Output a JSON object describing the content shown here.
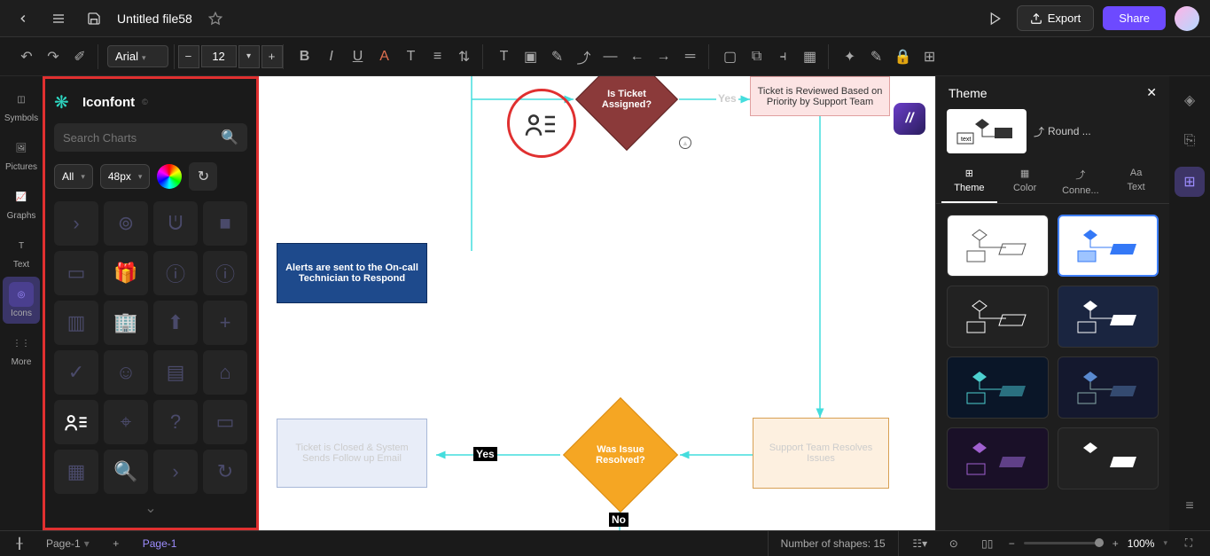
{
  "topbar": {
    "filename": "Untitled file58",
    "export_label": "Export",
    "share_label": "Share"
  },
  "toolbar": {
    "font": "Arial",
    "size": "12"
  },
  "left_nav": {
    "items": [
      "Symbols",
      "Pictures",
      "Graphs",
      "Text",
      "Icons",
      "More"
    ]
  },
  "icon_panel": {
    "title": "Iconfont",
    "search_placeholder": "Search Charts",
    "filter_all": "All",
    "size_label": "48px"
  },
  "flow": {
    "assigned": "Is Ticket Assigned?",
    "yes1": "Yes",
    "reviewed": "Ticket is Reviewed Based on Priority by Support Team",
    "alerts": "Alerts are sent to the On-call Technician to Respond",
    "resolved": "Was Issue Resolved?",
    "yes2": "Yes",
    "no": "No",
    "closed": "Ticket is Closed & System Sends Follow up Email",
    "resolves": "Support Team Resolves Issues"
  },
  "right": {
    "theme_title": "Theme",
    "round_label": "Round ...",
    "tabs": [
      "Theme",
      "Color",
      "Conne...",
      "Text"
    ]
  },
  "bottom": {
    "page": "Page-1",
    "page2": "Page-1",
    "shapes_label": "Number of shapes: 15",
    "zoom": "100%"
  },
  "chart_data": {
    "type": "flowchart",
    "nodes": [
      {
        "id": "assigned",
        "type": "decision",
        "text": "Is Ticket Assigned?"
      },
      {
        "id": "reviewed",
        "type": "process",
        "text": "Ticket is Reviewed Based on Priority by Support Team"
      },
      {
        "id": "alerts",
        "type": "process",
        "text": "Alerts are sent to the On-call Technician to Respond"
      },
      {
        "id": "resolves",
        "type": "process",
        "text": "Support Team Resolves Issues"
      },
      {
        "id": "resolved",
        "type": "decision",
        "text": "Was Issue Resolved?"
      },
      {
        "id": "closed",
        "type": "process",
        "text": "Ticket is Closed & System Sends Follow up Email"
      }
    ],
    "edges": [
      {
        "from": "assigned",
        "to": "reviewed",
        "label": "Yes"
      },
      {
        "from": "reviewed",
        "to": "resolves"
      },
      {
        "from": "resolves",
        "to": "resolved"
      },
      {
        "from": "resolved",
        "to": "closed",
        "label": "Yes"
      },
      {
        "from": "resolved",
        "to": null,
        "label": "No"
      }
    ],
    "shape_count": 15
  }
}
